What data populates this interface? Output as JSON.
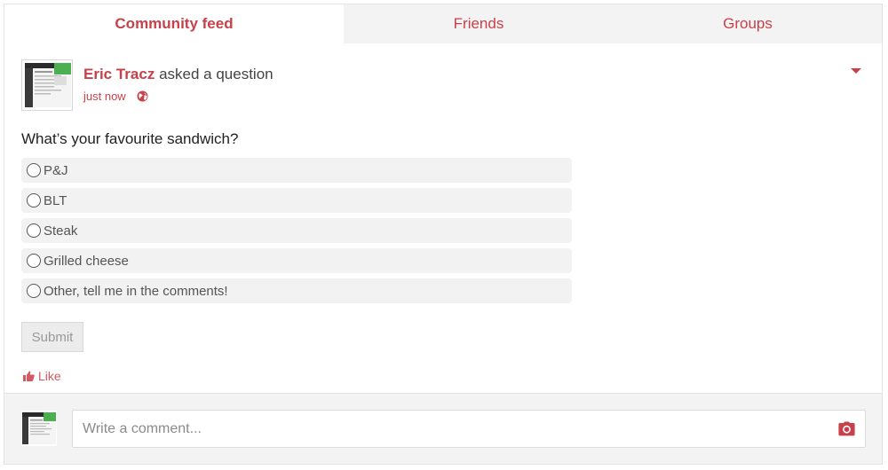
{
  "tabs": [
    {
      "label": "Community feed",
      "active": true
    },
    {
      "label": "Friends",
      "active": false
    },
    {
      "label": "Groups",
      "active": false
    }
  ],
  "post": {
    "author": "Eric Tracz",
    "action": "asked a question",
    "timestamp": "just now",
    "visibility_icon": "globe-icon",
    "menu_icon": "caret-down-icon",
    "question": "What’s your favourite sandwich?",
    "options": [
      "P&J",
      "BLT",
      "Steak",
      "Grilled cheese",
      "Other, tell me in the comments!"
    ],
    "submit_label": "Submit",
    "like_label": "Like",
    "like_icon": "thumbs-up-icon"
  },
  "comment": {
    "placeholder": "Write a comment...",
    "camera_icon": "camera-icon"
  },
  "colors": {
    "accent": "#c8414a",
    "like": "#d25a60",
    "tab_inactive_bg": "#f3f3f3",
    "option_bg": "#f2f2f2"
  }
}
